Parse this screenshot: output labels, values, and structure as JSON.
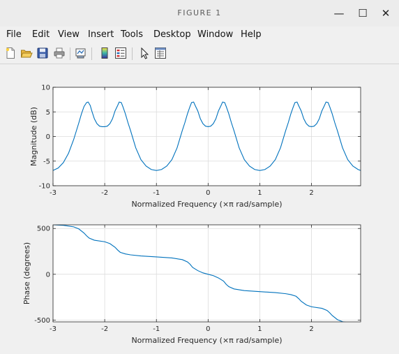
{
  "window": {
    "title": "FIGURE 1",
    "minimize": "—",
    "maximize": "☐",
    "close": "✕"
  },
  "menu": {
    "file": "File",
    "edit": "Edit",
    "view": "View",
    "insert": "Insert",
    "tools": "Tools",
    "desktop": "Desktop",
    "window": "Window",
    "help": "Help"
  },
  "toolbar": {
    "icons": [
      "new-figure-icon",
      "open-file-icon",
      "save-icon",
      "print-icon",
      "link-plot-icon",
      "insert-colorbar-icon",
      "insert-legend-icon",
      "edit-plot-icon",
      "property-inspector-icon"
    ]
  },
  "colors": {
    "line": "#0072bd",
    "grid": "#dcdcdc",
    "axes_bg": "#ffffff",
    "figure_bg": "#f0f0f0"
  },
  "chart_data": [
    {
      "type": "line",
      "title": "",
      "xlabel": "Normalized Frequency  (×π rad/sample)",
      "ylabel": "Magnitude (dB)",
      "xlim": [
        -3,
        2.95
      ],
      "ylim": [
        -10,
        10
      ],
      "xticks": [
        -3,
        -2,
        -1,
        0,
        1,
        2
      ],
      "yticks": [
        -10,
        -5,
        0,
        5,
        10
      ],
      "grid": true,
      "series": [
        {
          "x": [
            -3.0,
            -2.9,
            -2.8,
            -2.7,
            -2.6,
            -2.5,
            -2.45,
            -2.4,
            -2.35,
            -2.32,
            -2.28,
            -2.25,
            -2.2,
            -2.15,
            -2.1,
            -2.05,
            -2.0,
            -1.95,
            -1.9,
            -1.85,
            -1.8,
            -1.75,
            -1.72,
            -1.68,
            -1.65,
            -1.6,
            -1.55,
            -1.5,
            -1.4,
            -1.3,
            -1.2,
            -1.1,
            -1.0,
            -0.9,
            -0.8,
            -0.7,
            -0.6,
            -0.5,
            -0.45,
            -0.4,
            -0.35,
            -0.32,
            -0.28,
            -0.25,
            -0.2,
            -0.15,
            -0.1,
            -0.05,
            0.0,
            0.05,
            0.1,
            0.15,
            0.2,
            0.25,
            0.28,
            0.32,
            0.35,
            0.4,
            0.45,
            0.5,
            0.6,
            0.7,
            0.8,
            0.9,
            1.0,
            1.1,
            1.2,
            1.3,
            1.4,
            1.5,
            1.55,
            1.6,
            1.65,
            1.68,
            1.72,
            1.75,
            1.8,
            1.85,
            1.9,
            1.95,
            2.0,
            2.05,
            2.1,
            2.15,
            2.2,
            2.25,
            2.28,
            2.32,
            2.35,
            2.4,
            2.45,
            2.5,
            2.6,
            2.7,
            2.8,
            2.9,
            2.95
          ],
          "y": [
            -6.9,
            -6.4,
            -5.3,
            -3.4,
            -0.6,
            2.8,
            4.6,
            6.1,
            6.9,
            7.0,
            6.3,
            5.2,
            3.6,
            2.6,
            2.1,
            2.0,
            2.0,
            2.1,
            2.6,
            3.6,
            5.2,
            6.3,
            7.0,
            6.9,
            6.1,
            4.6,
            2.8,
            1.2,
            -2.3,
            -4.7,
            -6.0,
            -6.7,
            -6.9,
            -6.7,
            -6.0,
            -4.7,
            -2.3,
            1.2,
            2.8,
            4.6,
            6.1,
            6.9,
            7.0,
            6.3,
            5.2,
            3.6,
            2.6,
            2.1,
            2.0,
            2.1,
            2.6,
            3.6,
            5.2,
            6.3,
            7.0,
            6.9,
            6.1,
            4.6,
            2.8,
            1.2,
            -2.3,
            -4.7,
            -6.0,
            -6.7,
            -6.9,
            -6.7,
            -6.0,
            -4.7,
            -2.3,
            1.2,
            2.8,
            4.6,
            6.1,
            6.9,
            7.0,
            6.3,
            5.2,
            3.6,
            2.6,
            2.1,
            2.0,
            2.1,
            2.6,
            3.6,
            5.2,
            6.3,
            7.0,
            6.9,
            6.1,
            4.6,
            2.8,
            1.2,
            -2.3,
            -4.7,
            -6.0,
            -6.7,
            -6.9
          ]
        }
      ]
    },
    {
      "type": "line",
      "title": "",
      "xlabel": "Normalized Frequency  (×π rad/sample)",
      "ylabel": "Phase (degrees)",
      "xlim": [
        -3,
        2.95
      ],
      "ylim": [
        -520,
        540
      ],
      "xticks": [
        -3,
        -2,
        -1,
        0,
        1,
        2
      ],
      "yticks": [
        -500,
        0,
        500
      ],
      "grid": true,
      "series": [
        {
          "x": [
            -3.0,
            -2.8,
            -2.6,
            -2.5,
            -2.4,
            -2.35,
            -2.3,
            -2.2,
            -2.0,
            -1.9,
            -1.8,
            -1.75,
            -1.7,
            -1.6,
            -1.5,
            -1.3,
            -1.0,
            -0.7,
            -0.5,
            -0.4,
            -0.35,
            -0.3,
            -0.2,
            -0.1,
            0.0,
            0.1,
            0.2,
            0.3,
            0.35,
            0.4,
            0.5,
            0.7,
            1.0,
            1.3,
            1.5,
            1.6,
            1.7,
            1.75,
            1.8,
            1.9,
            2.0,
            2.2,
            2.3,
            2.35,
            2.4,
            2.5,
            2.6,
            2.8,
            2.95
          ],
          "y": [
            540,
            535,
            518,
            495,
            450,
            420,
            395,
            372,
            355,
            335,
            295,
            265,
            240,
            222,
            212,
            200,
            190,
            178,
            160,
            135,
            110,
            75,
            40,
            15,
            0,
            -15,
            -40,
            -75,
            -110,
            -135,
            -160,
            -178,
            -190,
            -200,
            -212,
            -222,
            -240,
            -265,
            -295,
            -335,
            -355,
            -372,
            -395,
            -420,
            -450,
            -495,
            -518,
            -535,
            -540
          ]
        }
      ]
    }
  ]
}
